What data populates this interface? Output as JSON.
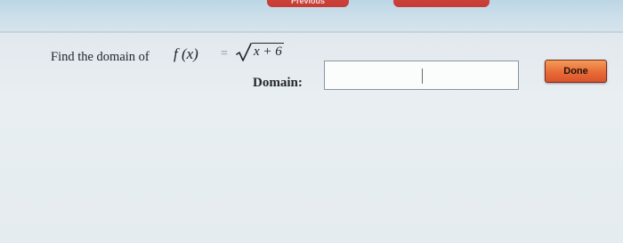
{
  "header": {
    "previous_label": "Previous",
    "next_label": ""
  },
  "question": {
    "prompt": "Find the domain of",
    "function_name": "f (x)",
    "equals": "=",
    "radicand": "x + 6"
  },
  "answer": {
    "label": "Domain:",
    "value": "",
    "placeholder": ""
  },
  "actions": {
    "done_label": "Done"
  },
  "colors": {
    "accent_red": "#c63b33",
    "done_orange": "#e86b37",
    "top_bar": "#c8dce8"
  }
}
